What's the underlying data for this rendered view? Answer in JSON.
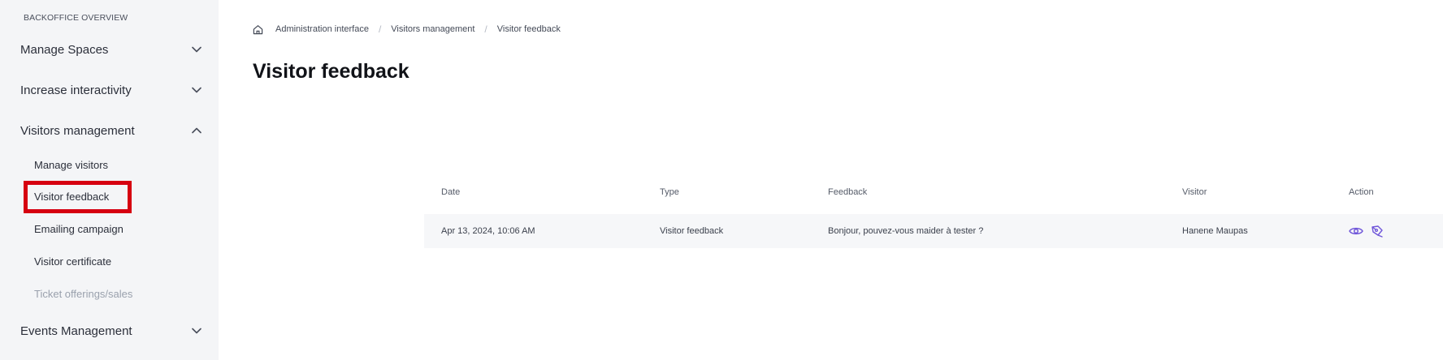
{
  "sidebar": {
    "heading": "BACKOFFICE OVERVIEW",
    "sections": [
      {
        "label": "Manage Spaces",
        "state": "collapsed"
      },
      {
        "label": "Increase interactivity",
        "state": "collapsed"
      },
      {
        "label": "Visitors management",
        "state": "expanded"
      },
      {
        "label": "Events Management",
        "state": "collapsed"
      }
    ],
    "visitors_items": [
      {
        "label": "Manage visitors"
      },
      {
        "label": "Visitor feedback",
        "active": true
      },
      {
        "label": "Emailing campaign"
      },
      {
        "label": "Visitor certificate"
      },
      {
        "label": "Ticket offerings/sales",
        "disabled": true
      }
    ]
  },
  "breadcrumb": {
    "items": [
      "Administration interface",
      "Visitors management",
      "Visitor feedback"
    ]
  },
  "page": {
    "title": "Visitor feedback"
  },
  "table": {
    "columns": [
      "Date",
      "Type",
      "Feedback",
      "Visitor",
      "Action"
    ],
    "rows": [
      {
        "date": "Apr 13, 2024, 10:06 AM",
        "type": "Visitor feedback",
        "feedback": "Bonjour, pouvez-vous maider à tester ?",
        "visitor": "Hanene Maupas",
        "actions": [
          "eye-icon",
          "edit-pen-icon"
        ]
      }
    ]
  },
  "colors": {
    "accent": "#6f56d9",
    "highlight": "#d60010",
    "sidebar_bg": "#f4f5f7",
    "row_bg": "#f6f7f9"
  }
}
